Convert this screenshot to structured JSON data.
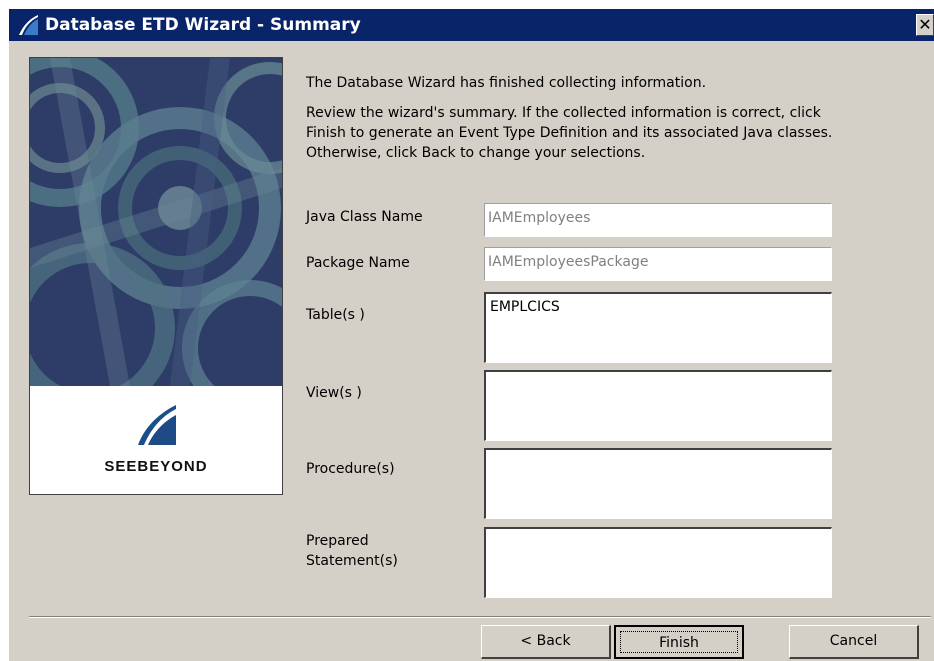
{
  "window": {
    "title": "Database ETD Wizard - Summary",
    "close_glyph": "✕",
    "icons": {
      "title": "seebeyond-logo-icon",
      "close": "close-icon"
    }
  },
  "splash": {
    "brand": "SEEBEYOND"
  },
  "summary": {
    "intro": "The Database Wizard has finished collecting information.",
    "review": "Review the wizard's summary.  If the collected information is correct, click Finish to generate an Event Type Definition and its associated Java classes.  Otherwise, click Back to change your selections."
  },
  "fields": {
    "java_class_name": {
      "label": "Java Class Name",
      "value": "IAMEmployees"
    },
    "package_name": {
      "label": "Package Name",
      "value": "IAMEmployeesPackage"
    },
    "tables": {
      "label": "Table(s )",
      "value": "EMPLCICS"
    },
    "views": {
      "label": "View(s )",
      "value": ""
    },
    "procedures": {
      "label": "Procedure(s)",
      "value": ""
    },
    "prepared_statements": {
      "label_line1": "Prepared",
      "label_line2": "Statement(s)",
      "value": ""
    }
  },
  "buttons": {
    "back": "< Back",
    "finish": "Finish",
    "cancel": "Cancel"
  },
  "colors": {
    "titlebar": "#0a246a",
    "dialog_bg": "#d4d0c8"
  }
}
